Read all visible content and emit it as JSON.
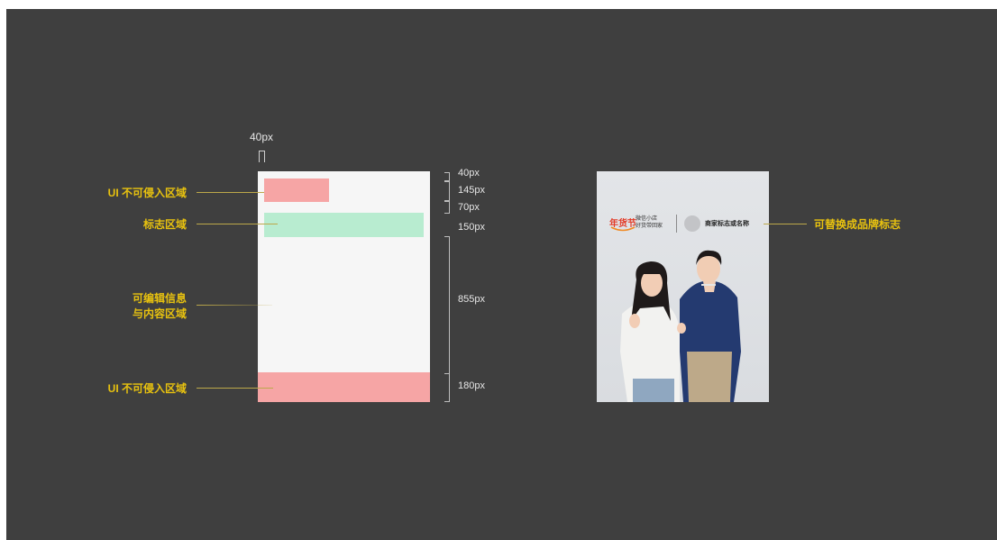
{
  "diagram": {
    "top_dimension": "40px",
    "dimensions": [
      "40px",
      "145px",
      "70px",
      "150px",
      "855px",
      "180px"
    ],
    "labels": {
      "ui_no_intrude_top": "UI 不可侵入区域",
      "logo_area": "标志区域",
      "editable_line1": "可编辑信息",
      "editable_line2": "与内容区域",
      "ui_no_intrude_bottom": "UI 不可侵入区域",
      "replaceable_brand": "可替换成品牌标志"
    }
  },
  "preview": {
    "brand_main": "年货节",
    "brand_sub1": "微信小店",
    "brand_sub2": "好货带回家",
    "merchant": "商家标志或名称"
  },
  "colors": {
    "background": "#3f3f3f",
    "frame": "#f6f6f6",
    "no_intrude": "#f6a5a5",
    "logo_area": "#b8ecd0",
    "label": "#e8c20f",
    "brand_red": "#e33b27"
  }
}
